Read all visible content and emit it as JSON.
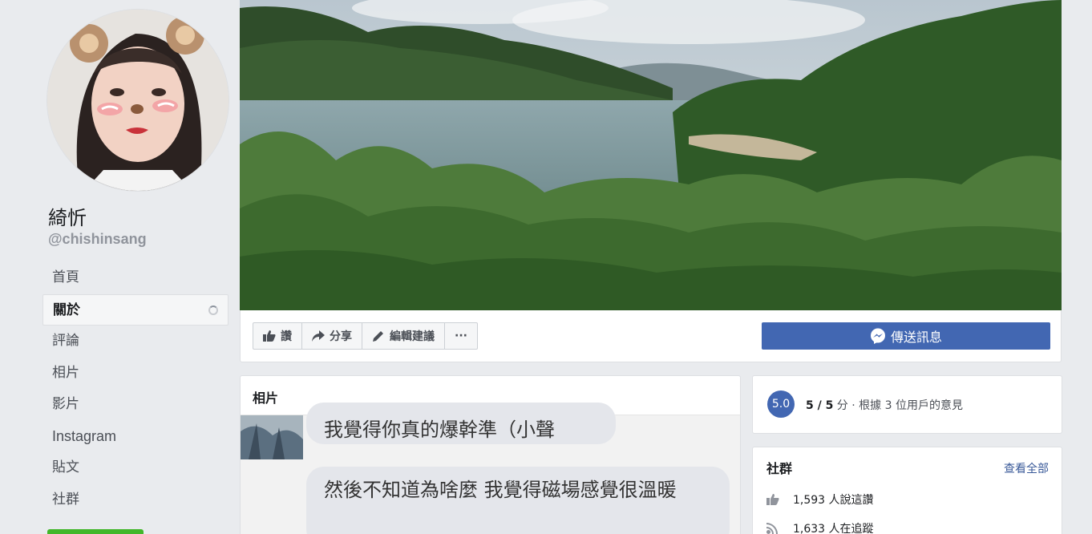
{
  "page": {
    "name": "綺忻",
    "handle": "@chishinsang"
  },
  "nav": {
    "items": [
      {
        "label": "首頁"
      },
      {
        "label": "關於"
      },
      {
        "label": "評論"
      },
      {
        "label": "相片"
      },
      {
        "label": "影片"
      },
      {
        "label": "Instagram"
      },
      {
        "label": "貼文"
      },
      {
        "label": "社群"
      }
    ]
  },
  "actions": {
    "like": "讚",
    "share": "分享",
    "suggest_edits": "編輯建議",
    "more": "···",
    "send_message": "傳送訊息"
  },
  "photos": {
    "title": "相片",
    "message_1": "我覺得你真的爆幹準（小聲",
    "message_2": "然後不知道為啥麼 我覺得磁場感覺很溫暖"
  },
  "rating": {
    "badge": "5.0",
    "score": "5 / 5",
    "unit": "分",
    "description": " · 根據 3 位用戶的意見"
  },
  "community": {
    "title": "社群",
    "see_all": "查看全部",
    "likes": "1,593 人說這讚",
    "follows": "1,633 人在追蹤"
  },
  "colors": {
    "brand_blue": "#4267b2",
    "link_blue": "#385898",
    "page_bg": "#e9ebee",
    "green": "#42b72a"
  }
}
